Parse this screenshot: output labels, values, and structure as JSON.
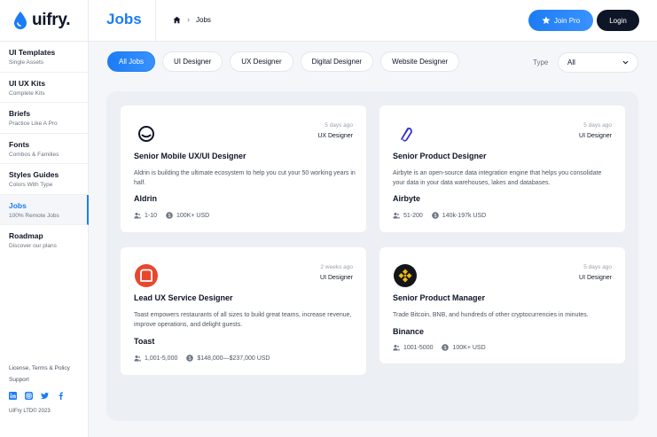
{
  "brand": {
    "name": "uifry.",
    "accent": "#1c7cf5",
    "dark": "#0e1526"
  },
  "sidebar": {
    "items": [
      {
        "title": "UI Templates",
        "subtitle": "Single Assets"
      },
      {
        "title": "UI UX Kits",
        "subtitle": "Complete Kits"
      },
      {
        "title": "Briefs",
        "subtitle": "Practice Like A Pro"
      },
      {
        "title": "Fonts",
        "subtitle": "Combos & Families"
      },
      {
        "title": "Styles Guides",
        "subtitle": "Colors With Type"
      },
      {
        "title": "Jobs",
        "subtitle": "100% Remote Jobs"
      },
      {
        "title": "Roadmap",
        "subtitle": "Discover our plans"
      }
    ],
    "footer": {
      "license": "License, Terms & Policy",
      "support": "Support",
      "copyright": "UIFry LTD© 2023"
    },
    "socials": [
      "linkedin-icon",
      "instagram-icon",
      "twitter-icon",
      "facebook-icon"
    ]
  },
  "header": {
    "title": "Jobs",
    "breadcrumb": {
      "home_icon": "home-icon",
      "current": "Jobs"
    },
    "join_pro": "Join Pro",
    "login": "Login"
  },
  "filters": {
    "chips": [
      "All Jobs",
      "UI Designer",
      "UX Designer",
      "Digital Designer",
      "Website Designer"
    ],
    "active_chip": "All Jobs",
    "type_label": "Type",
    "type_value": "All"
  },
  "jobs": [
    {
      "logo": "aldrin-logo",
      "posted": "5 days ago",
      "tag": "UX Designer",
      "title": "Senior Mobile UX/UI Designer",
      "description": "Aldrin is building the ultimate ecosystem to help you cut your 50 working years in half.",
      "company": "Aldrin",
      "size": "1-10",
      "salary": "100K+ USD"
    },
    {
      "logo": "airbyte-logo",
      "posted": "5 days ago",
      "tag": "UI Designer",
      "title": "Senior Product Designer",
      "description": "Airbyte is an open-source data integration engine that helps you consolidate your data in your data warehouses, lakes and databases.",
      "company": "Airbyte",
      "size": "51-200",
      "salary": "140k-197k USD"
    },
    {
      "logo": "toast-logo",
      "posted": "2 weeks ago",
      "tag": "UI Designer",
      "title": "Lead UX Service Designer",
      "description": "Toast empowers restaurants of all sizes to build great teams, increase revenue, improve operations, and delight guests.",
      "company": "Toast",
      "size": "1,001-5,000",
      "salary": "$148,000—$237,000 USD"
    },
    {
      "logo": "binance-logo",
      "posted": "5 days ago",
      "tag": "UI Designer",
      "title": "Senior Product Manager",
      "description": "Trade Bitcoin, BNB, and hundreds of other cryptocurrencies in minutes.",
      "company": "Binance",
      "size": "1001-5000",
      "salary": "100K+ USD"
    }
  ]
}
